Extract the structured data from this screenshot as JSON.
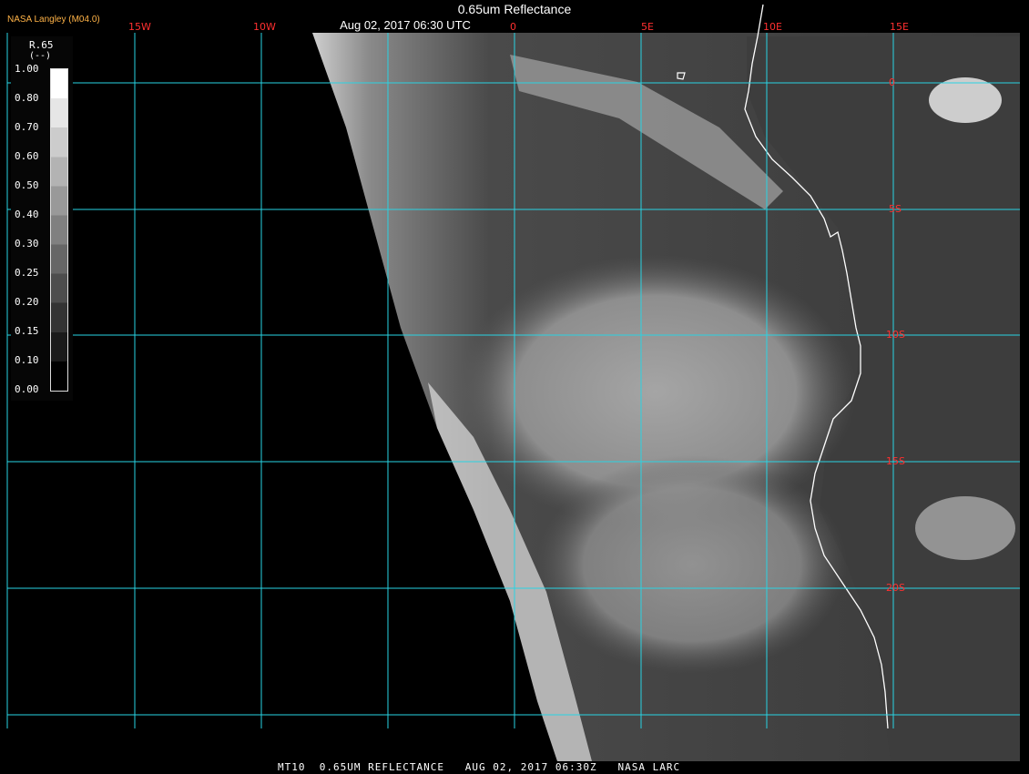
{
  "window": {
    "title": "0.65um Reflectance",
    "subtitle": "Aug 02, 2017 06:30 UTC",
    "credit": "NASA Langley (M04.0)",
    "footer": "MT10  0.65UM REFLECTANCE   AUG 02, 2017 06:30Z   NASA LARC"
  },
  "map": {
    "projection": "satellite imagery",
    "grid_color": "#29d3e3",
    "coast_color": "#ffffff",
    "label_color": "#ff3030",
    "lon_labels": [
      "15W",
      "10W",
      "0",
      "5E",
      "10E",
      "15E"
    ],
    "lat_labels": [
      "0",
      "5S",
      "10S",
      "15S",
      "20S"
    ]
  },
  "legend": {
    "title": "R.65",
    "unit": "(--)",
    "ticks": [
      "1.00",
      "0.80",
      "0.70",
      "0.60",
      "0.50",
      "0.40",
      "0.30",
      "0.25",
      "0.20",
      "0.15",
      "0.10",
      "0.00"
    ],
    "ramp_from": "#000000",
    "ramp_to": "#ffffff"
  }
}
